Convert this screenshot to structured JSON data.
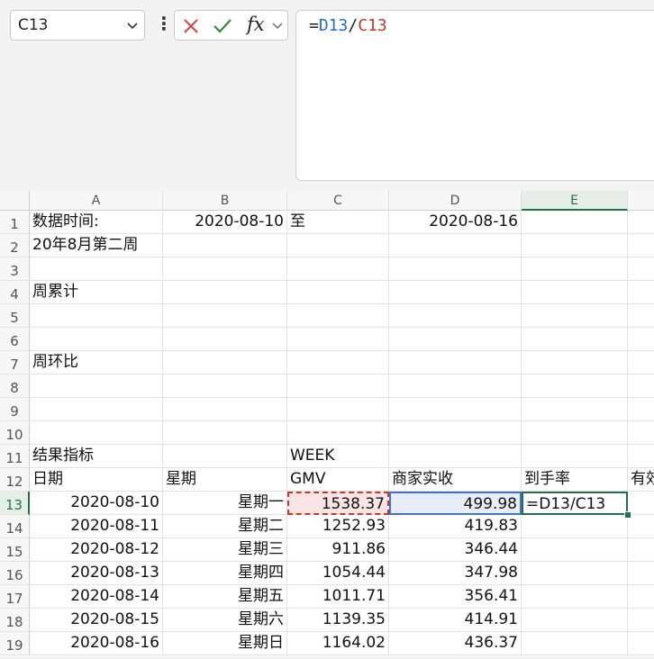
{
  "formula_bar": {
    "name_box": "C13",
    "cancel_icon": "close-icon",
    "confirm_icon": "check-icon",
    "fx_label": "fx",
    "formula_prefix": "=",
    "formula_ref1": "D13",
    "formula_op": "/",
    "formula_ref2": "C13",
    "colors": {
      "ref1": "#1f6fd1",
      "ref2": "#c0392b",
      "cancel": "#e04040",
      "confirm": "#2e8b3e"
    }
  },
  "sheet": {
    "columns": [
      "A",
      "B",
      "C",
      "D",
      "E"
    ],
    "selected_column": "E",
    "selected_row": "13",
    "rows": [
      "1",
      "2",
      "3",
      "4",
      "5",
      "6",
      "7",
      "8",
      "9",
      "10",
      "11",
      "12",
      "13",
      "14",
      "15",
      "16",
      "17",
      "18",
      "19"
    ],
    "cells": {
      "A1": "数据时间:",
      "B1": "2020-08-10",
      "C1": "至",
      "D1": "2020-08-16",
      "A2": "20年8月第二周",
      "A4": "周累计",
      "A7": "周环比",
      "A11": "结果指标",
      "C11": "WEEK",
      "A12": "日期",
      "B12": "星期",
      "C12": "GMV",
      "D12": "商家实收",
      "E12": "到手率",
      "F12": "有效",
      "A13": "2020-08-10",
      "B13": "星期一",
      "C13": "1538.37",
      "D13": "499.98",
      "E13": "=D13/C13",
      "A14": "2020-08-11",
      "B14": "星期二",
      "C14": "1252.93",
      "D14": "419.83",
      "A15": "2020-08-12",
      "B15": "星期三",
      "C15": "911.86",
      "D15": "346.44",
      "A16": "2020-08-13",
      "B16": "星期四",
      "C16": "1054.44",
      "D16": "347.98",
      "A17": "2020-08-14",
      "B17": "星期五",
      "C17": "1011.71",
      "D17": "356.41",
      "A18": "2020-08-15",
      "B18": "星期六",
      "C18": "1139.35",
      "D18": "414.91",
      "A19": "2020-08-16",
      "B19": "星期日",
      "C19": "1164.02",
      "D19": "436.37"
    }
  }
}
